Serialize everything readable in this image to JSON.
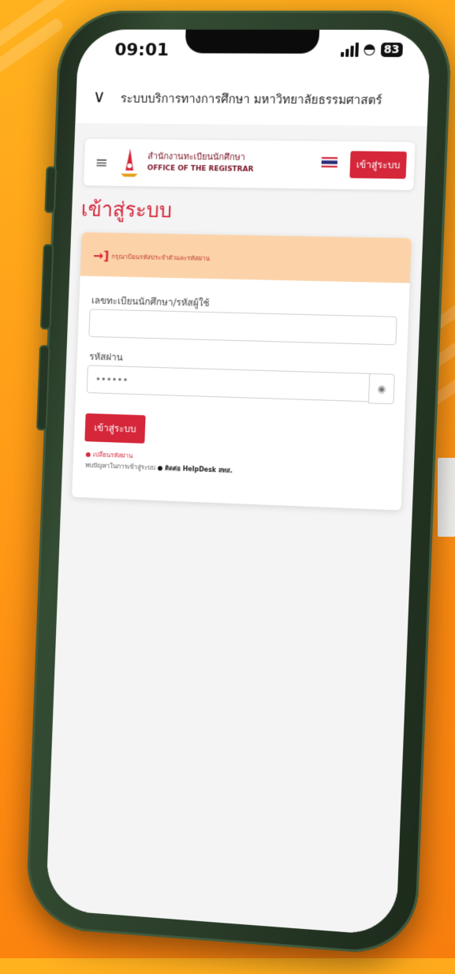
{
  "status_bar": {
    "time": "09:01",
    "battery": "83"
  },
  "browser": {
    "title": "ระบบบริการทางการศึกษา มหาวิทยาลัยธรรมศาสตร์"
  },
  "nav": {
    "brand_th": "สำนักงานทะเบียนนักศึกษา",
    "brand_en": "OFFICE OF THE REGISTRAR",
    "login_button": "เข้าสู่ระบบ"
  },
  "page": {
    "title": "เข้าสู่ระบบ",
    "alert": "กรุณาป้อนรหัสประจำตัวและรหัสผ่าน",
    "username_label": "เลขทะเบียนนักศึกษา/รหัสผู้ใช้",
    "username_value": "",
    "password_label": "รหัสผ่าน",
    "password_placeholder": "••••••",
    "submit_label": "เข้าสู่ระบบ",
    "change_password": "เปลี่ยนรหัสผ่าน",
    "help_prefix": "พบปัญหาในการเข้าสู่ระบบ",
    "help_contact": "ติดต่อ HelpDesk สทส."
  },
  "colors": {
    "accent": "#d5263a",
    "alert_bg": "#fcd3a9",
    "background": "#ff9a16",
    "phone_frame": "#2a3d29"
  },
  "icons": {
    "chevron": "chevron-down-icon",
    "hamburger": "hamburger-menu-icon",
    "eye": "eye-icon",
    "alert": "login-arrow-icon",
    "wifi": "wifi-icon",
    "bubble": "chat-bubble-icon"
  }
}
